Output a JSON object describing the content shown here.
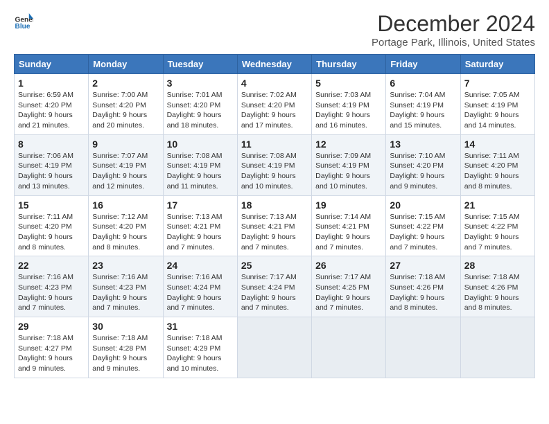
{
  "logo": {
    "line1": "General",
    "line2": "Blue"
  },
  "title": "December 2024",
  "subtitle": "Portage Park, Illinois, United States",
  "days_of_week": [
    "Sunday",
    "Monday",
    "Tuesday",
    "Wednesday",
    "Thursday",
    "Friday",
    "Saturday"
  ],
  "weeks": [
    [
      {
        "day": 1,
        "sunrise": "6:59 AM",
        "sunset": "4:20 PM",
        "daylight": "9 hours and 21 minutes."
      },
      {
        "day": 2,
        "sunrise": "7:00 AM",
        "sunset": "4:20 PM",
        "daylight": "9 hours and 20 minutes."
      },
      {
        "day": 3,
        "sunrise": "7:01 AM",
        "sunset": "4:20 PM",
        "daylight": "9 hours and 18 minutes."
      },
      {
        "day": 4,
        "sunrise": "7:02 AM",
        "sunset": "4:20 PM",
        "daylight": "9 hours and 17 minutes."
      },
      {
        "day": 5,
        "sunrise": "7:03 AM",
        "sunset": "4:19 PM",
        "daylight": "9 hours and 16 minutes."
      },
      {
        "day": 6,
        "sunrise": "7:04 AM",
        "sunset": "4:19 PM",
        "daylight": "9 hours and 15 minutes."
      },
      {
        "day": 7,
        "sunrise": "7:05 AM",
        "sunset": "4:19 PM",
        "daylight": "9 hours and 14 minutes."
      }
    ],
    [
      {
        "day": 8,
        "sunrise": "7:06 AM",
        "sunset": "4:19 PM",
        "daylight": "9 hours and 13 minutes."
      },
      {
        "day": 9,
        "sunrise": "7:07 AM",
        "sunset": "4:19 PM",
        "daylight": "9 hours and 12 minutes."
      },
      {
        "day": 10,
        "sunrise": "7:08 AM",
        "sunset": "4:19 PM",
        "daylight": "9 hours and 11 minutes."
      },
      {
        "day": 11,
        "sunrise": "7:08 AM",
        "sunset": "4:19 PM",
        "daylight": "9 hours and 10 minutes."
      },
      {
        "day": 12,
        "sunrise": "7:09 AM",
        "sunset": "4:19 PM",
        "daylight": "9 hours and 10 minutes."
      },
      {
        "day": 13,
        "sunrise": "7:10 AM",
        "sunset": "4:20 PM",
        "daylight": "9 hours and 9 minutes."
      },
      {
        "day": 14,
        "sunrise": "7:11 AM",
        "sunset": "4:20 PM",
        "daylight": "9 hours and 8 minutes."
      }
    ],
    [
      {
        "day": 15,
        "sunrise": "7:11 AM",
        "sunset": "4:20 PM",
        "daylight": "9 hours and 8 minutes."
      },
      {
        "day": 16,
        "sunrise": "7:12 AM",
        "sunset": "4:20 PM",
        "daylight": "9 hours and 8 minutes."
      },
      {
        "day": 17,
        "sunrise": "7:13 AM",
        "sunset": "4:21 PM",
        "daylight": "9 hours and 7 minutes."
      },
      {
        "day": 18,
        "sunrise": "7:13 AM",
        "sunset": "4:21 PM",
        "daylight": "9 hours and 7 minutes."
      },
      {
        "day": 19,
        "sunrise": "7:14 AM",
        "sunset": "4:21 PM",
        "daylight": "9 hours and 7 minutes."
      },
      {
        "day": 20,
        "sunrise": "7:15 AM",
        "sunset": "4:22 PM",
        "daylight": "9 hours and 7 minutes."
      },
      {
        "day": 21,
        "sunrise": "7:15 AM",
        "sunset": "4:22 PM",
        "daylight": "9 hours and 7 minutes."
      }
    ],
    [
      {
        "day": 22,
        "sunrise": "7:16 AM",
        "sunset": "4:23 PM",
        "daylight": "9 hours and 7 minutes."
      },
      {
        "day": 23,
        "sunrise": "7:16 AM",
        "sunset": "4:23 PM",
        "daylight": "9 hours and 7 minutes."
      },
      {
        "day": 24,
        "sunrise": "7:16 AM",
        "sunset": "4:24 PM",
        "daylight": "9 hours and 7 minutes."
      },
      {
        "day": 25,
        "sunrise": "7:17 AM",
        "sunset": "4:24 PM",
        "daylight": "9 hours and 7 minutes."
      },
      {
        "day": 26,
        "sunrise": "7:17 AM",
        "sunset": "4:25 PM",
        "daylight": "9 hours and 7 minutes."
      },
      {
        "day": 27,
        "sunrise": "7:18 AM",
        "sunset": "4:26 PM",
        "daylight": "9 hours and 8 minutes."
      },
      {
        "day": 28,
        "sunrise": "7:18 AM",
        "sunset": "4:26 PM",
        "daylight": "9 hours and 8 minutes."
      }
    ],
    [
      {
        "day": 29,
        "sunrise": "7:18 AM",
        "sunset": "4:27 PM",
        "daylight": "9 hours and 9 minutes."
      },
      {
        "day": 30,
        "sunrise": "7:18 AM",
        "sunset": "4:28 PM",
        "daylight": "9 hours and 9 minutes."
      },
      {
        "day": 31,
        "sunrise": "7:18 AM",
        "sunset": "4:29 PM",
        "daylight": "9 hours and 10 minutes."
      },
      null,
      null,
      null,
      null
    ]
  ]
}
